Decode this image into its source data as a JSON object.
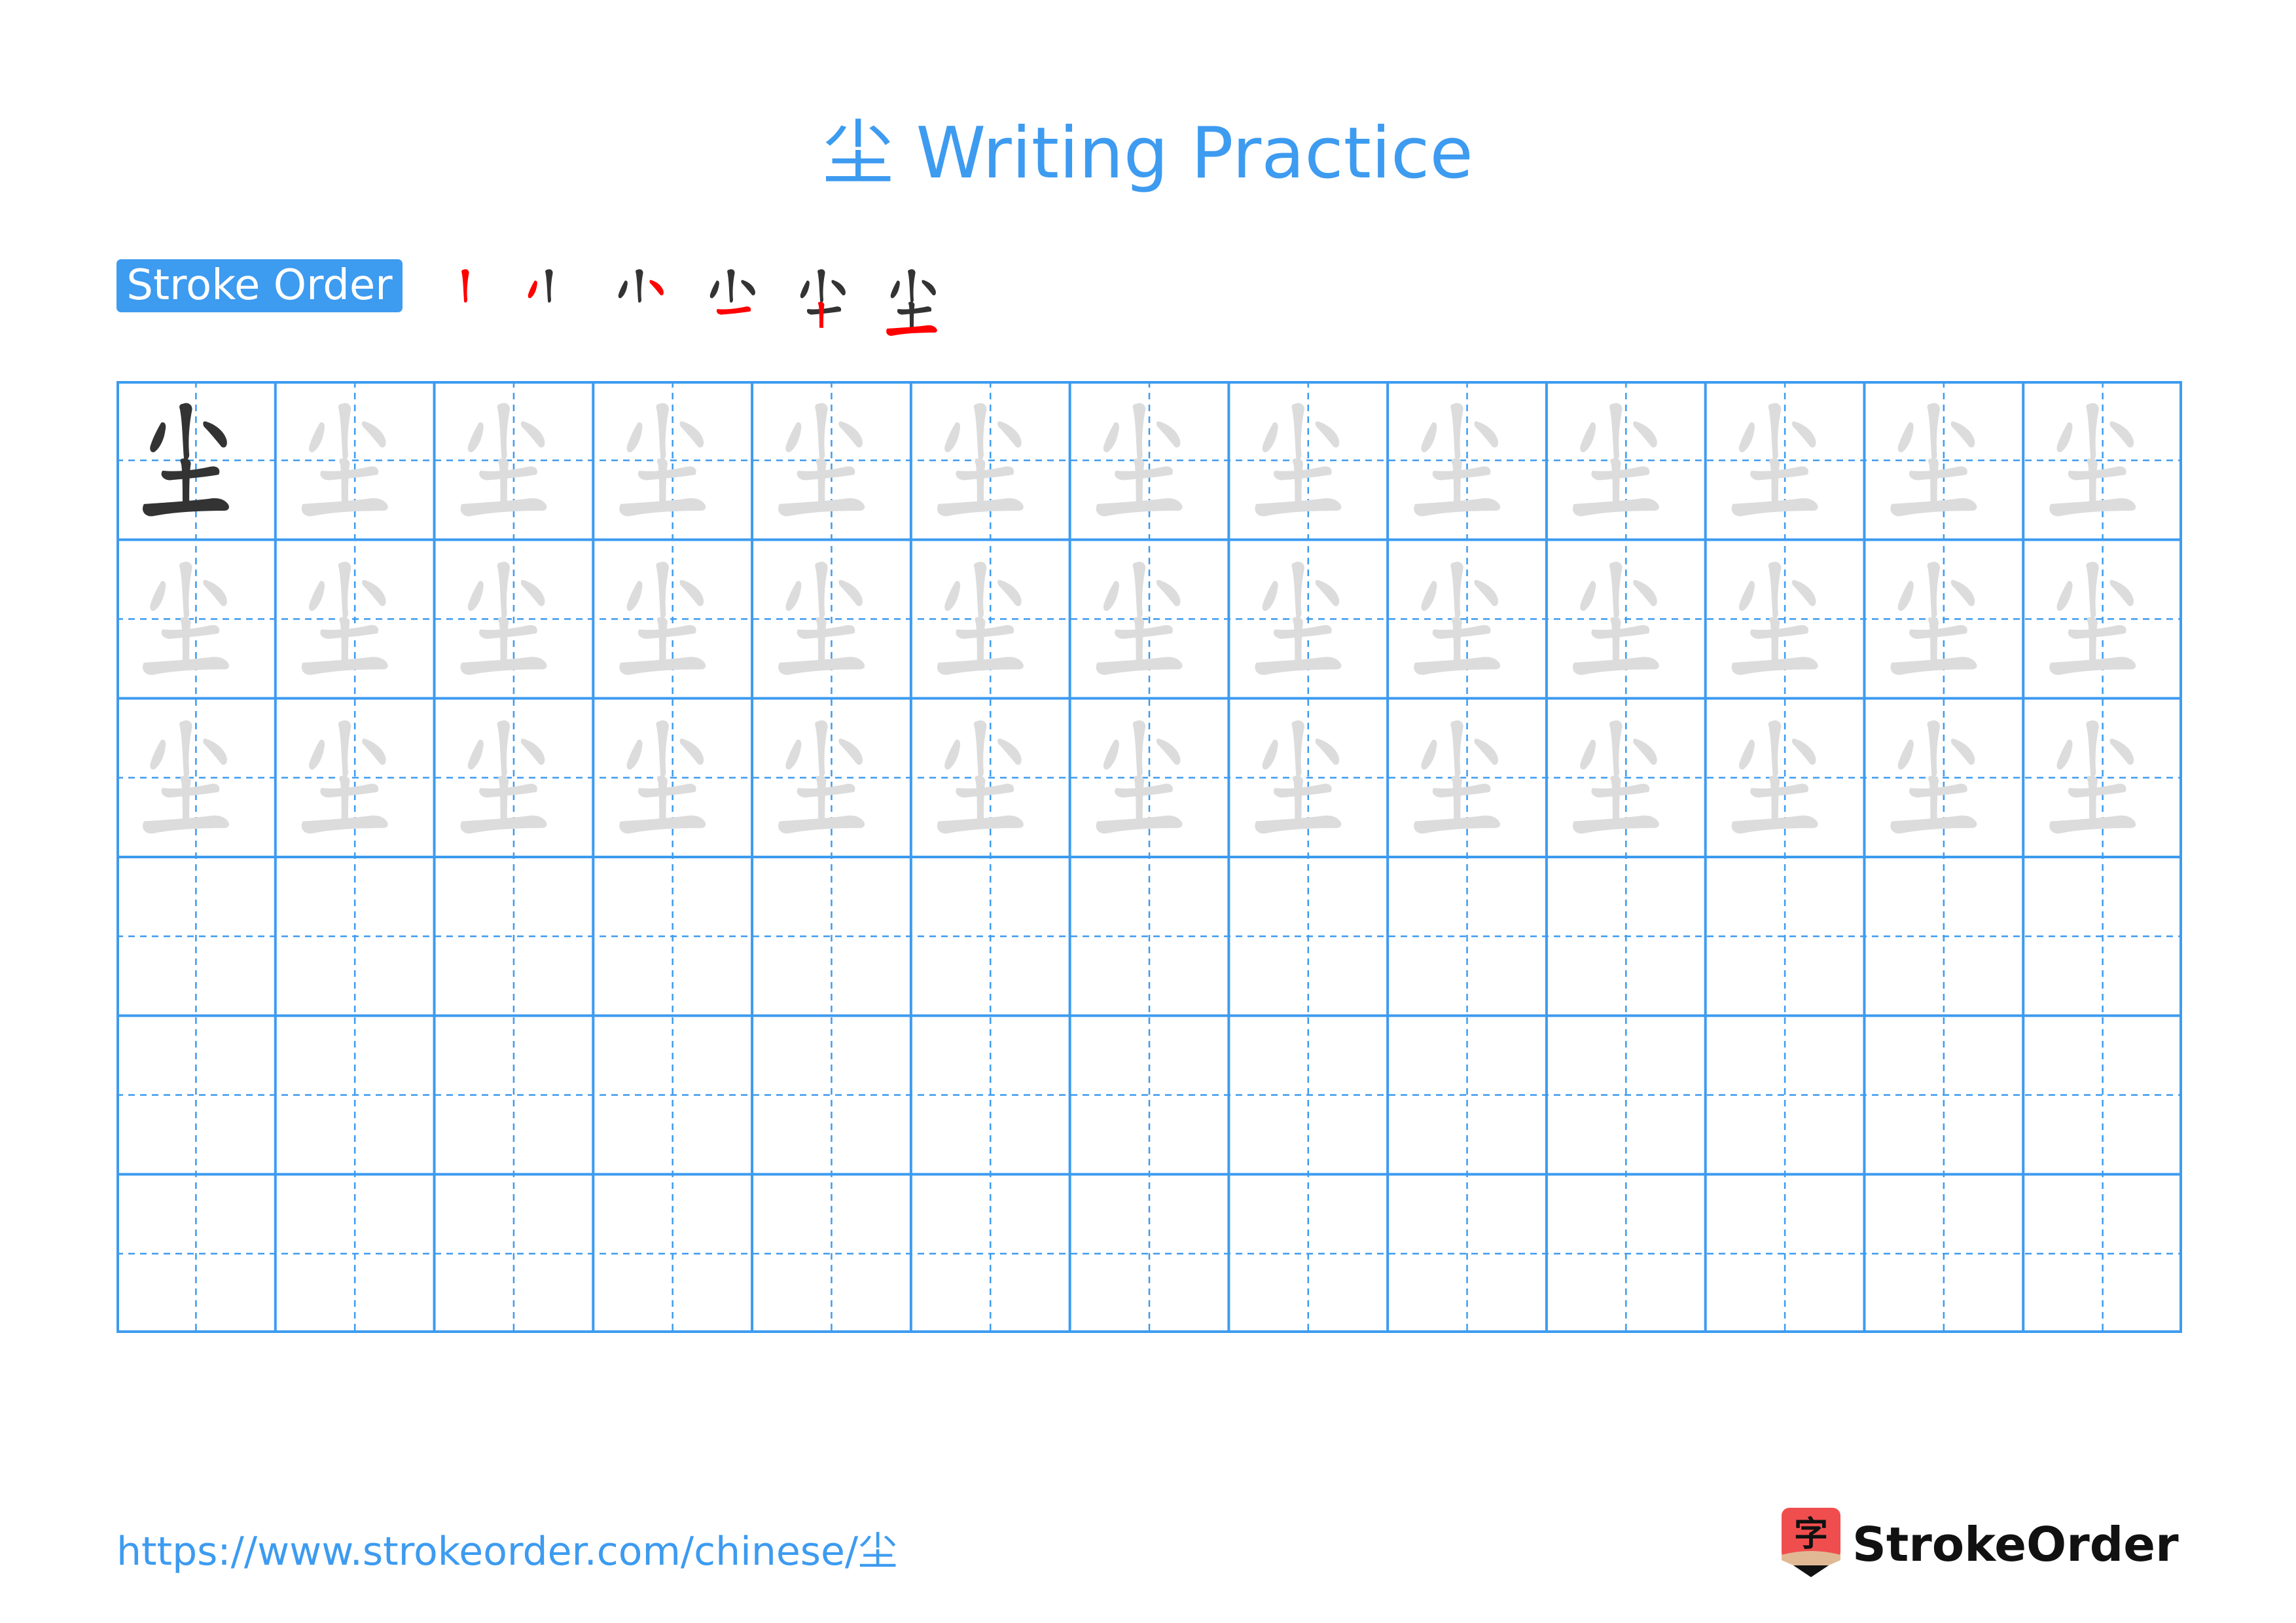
{
  "page": {
    "character": "尘",
    "title": "尘 Writing Practice",
    "stroke_order_label": "Stroke Order",
    "stroke_count": 6,
    "footer_url": "https://www.strokeorder.com/chinese/尘",
    "brand_name": "StrokeOrder",
    "logo_glyph": "字"
  },
  "colors": {
    "accent": "#3d9bf0",
    "current_stroke": "#ff0000",
    "done_stroke": "#333333",
    "trace_stroke": "#dcdcdc",
    "model_stroke": "#333333",
    "logo_red": "#f04e4e",
    "logo_tan": "#e0b994"
  },
  "grid": {
    "rows": 6,
    "columns": 13,
    "model_cells": 1,
    "trace_rows": 3,
    "empty_rows": 3
  },
  "stroke_steps": [
    {
      "step": 1,
      "done": 0,
      "current": 1
    },
    {
      "step": 2,
      "done": 1,
      "current": 2
    },
    {
      "step": 3,
      "done": 2,
      "current": 3
    },
    {
      "step": 4,
      "done": 3,
      "current": 4
    },
    {
      "step": 5,
      "done": 4,
      "current": 5
    },
    {
      "step": 6,
      "done": 5,
      "current": 6
    }
  ]
}
